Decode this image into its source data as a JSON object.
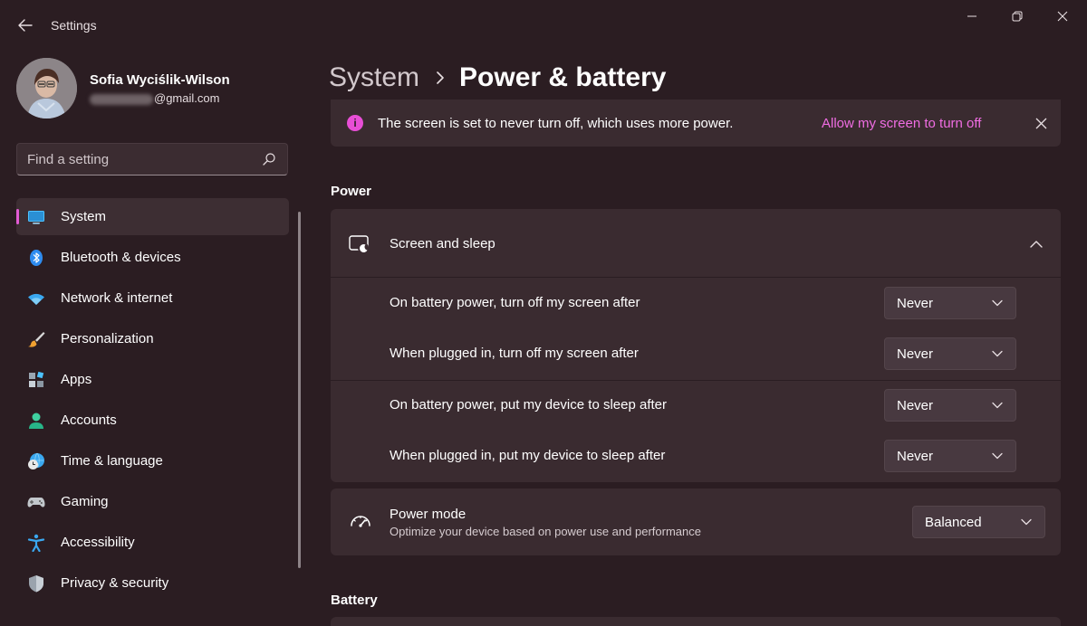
{
  "window": {
    "app_title": "Settings",
    "controls": [
      "minimize",
      "restore",
      "close"
    ]
  },
  "profile": {
    "name": "Sofia Wyciślik-Wilson",
    "email_visible": "@gmail.com"
  },
  "search": {
    "placeholder": "Find a setting",
    "value": ""
  },
  "sidebar": {
    "items": [
      {
        "label": "System",
        "icon": "monitor-icon",
        "active": true
      },
      {
        "label": "Bluetooth & devices",
        "icon": "bluetooth-icon",
        "active": false
      },
      {
        "label": "Network & internet",
        "icon": "wifi-icon",
        "active": false
      },
      {
        "label": "Personalization",
        "icon": "brush-icon",
        "active": false
      },
      {
        "label": "Apps",
        "icon": "apps-icon",
        "active": false
      },
      {
        "label": "Accounts",
        "icon": "person-icon",
        "active": false
      },
      {
        "label": "Time & language",
        "icon": "globe-clock-icon",
        "active": false
      },
      {
        "label": "Gaming",
        "icon": "gamepad-icon",
        "active": false
      },
      {
        "label": "Accessibility",
        "icon": "accessibility-icon",
        "active": false
      },
      {
        "label": "Privacy & security",
        "icon": "shield-icon",
        "active": false
      }
    ]
  },
  "breadcrumb": {
    "parent": "System",
    "current": "Power & battery"
  },
  "notice": {
    "icon_glyph": "i",
    "text": "The screen is set to never turn off, which uses more power.",
    "link": "Allow my screen to turn off"
  },
  "power_section": {
    "title": "Power",
    "screen_sleep": {
      "title": "Screen and sleep",
      "expanded": true,
      "rows": [
        {
          "label": "On battery power, turn off my screen after",
          "value": "Never"
        },
        {
          "label": "When plugged in, turn off my screen after",
          "value": "Never"
        },
        {
          "label": "On battery power, put my device to sleep after",
          "value": "Never"
        },
        {
          "label": "When plugged in, put my device to sleep after",
          "value": "Never"
        }
      ]
    },
    "power_mode": {
      "title": "Power mode",
      "subtitle": "Optimize your device based on power use and performance",
      "value": "Balanced"
    }
  },
  "battery_section": {
    "title": "Battery"
  },
  "colors": {
    "background": "#2b1d22",
    "card": "#3a2b30",
    "accent": "#e35bd4",
    "link": "#f06de3"
  }
}
